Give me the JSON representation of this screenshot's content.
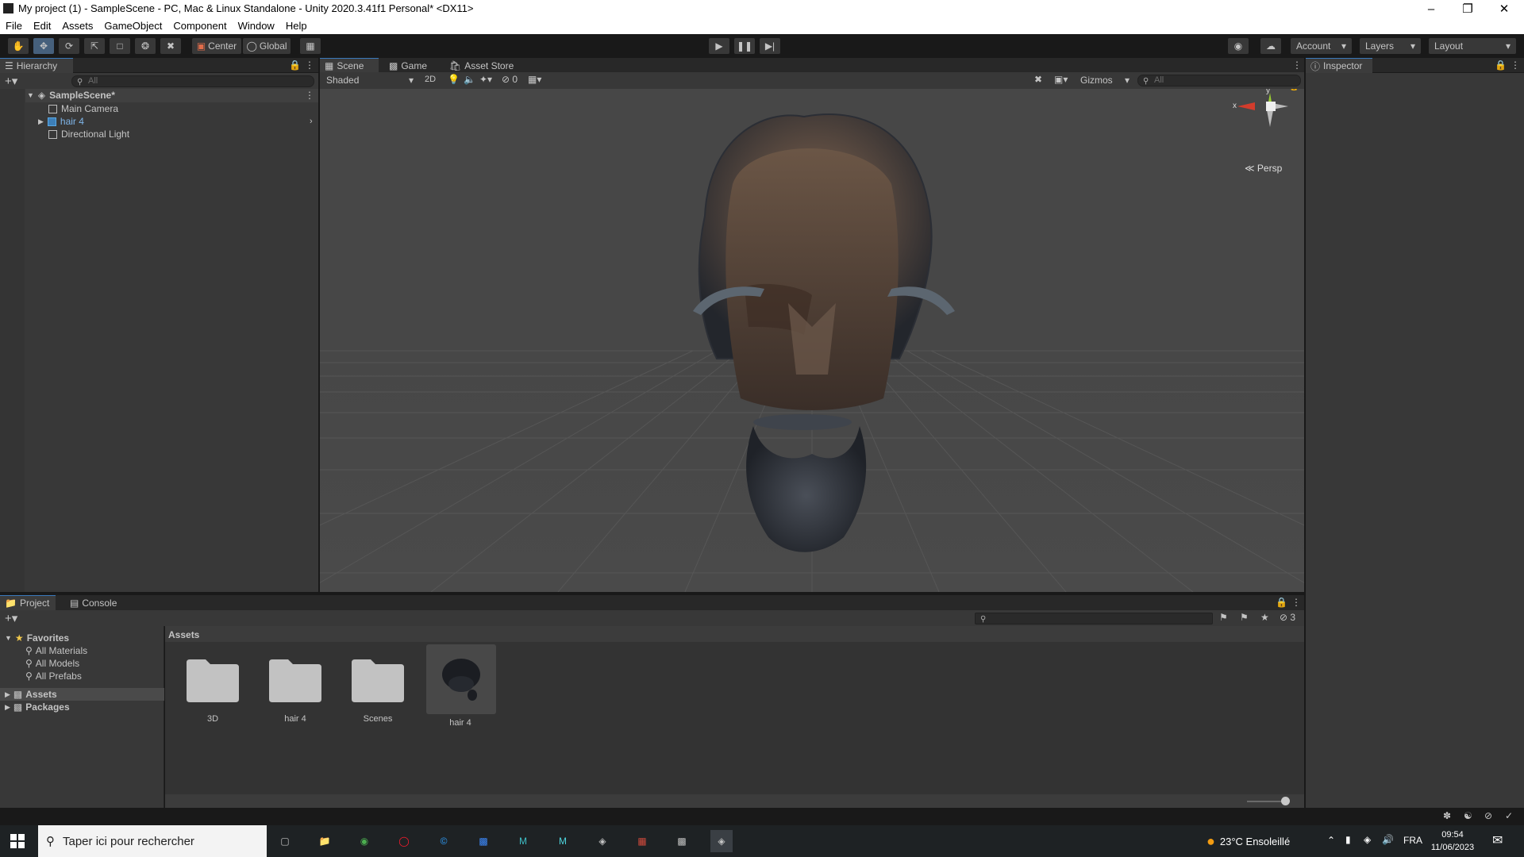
{
  "window": {
    "title": "My project (1) - SampleScene - PC, Mac & Linux Standalone - Unity 2020.3.41f1 Personal* <DX11>"
  },
  "menu": [
    "File",
    "Edit",
    "Assets",
    "GameObject",
    "Component",
    "Window",
    "Help"
  ],
  "toolbar": {
    "pivot": "Center",
    "space": "Global",
    "account": "Account",
    "layers": "Layers",
    "layout": "Layout"
  },
  "hierarchy": {
    "tab": "Hierarchy",
    "search_placeholder": "All",
    "scene": "SampleScene*",
    "items": [
      "Main Camera",
      "hair 4",
      "Directional Light"
    ]
  },
  "scene": {
    "tabs": [
      "Scene",
      "Game",
      "Asset Store"
    ],
    "shading": "Shaded",
    "mode2d": "2D",
    "hidden_count": "0",
    "gizmos": "Gizmos",
    "search_placeholder": "All",
    "gizmo_y": "y",
    "gizmo_x": "x",
    "persp": "Persp"
  },
  "inspector": {
    "tab": "Inspector"
  },
  "project": {
    "tabs": [
      "Project",
      "Console"
    ],
    "hidden_count": "3",
    "favorites_label": "Favorites",
    "favorites": [
      "All Materials",
      "All Models",
      "All Prefabs"
    ],
    "roots": [
      "Assets",
      "Packages"
    ],
    "breadcrumb": "Assets",
    "assets": [
      {
        "name": "3D",
        "kind": "folder"
      },
      {
        "name": "hair 4",
        "kind": "folder"
      },
      {
        "name": "Scenes",
        "kind": "folder"
      },
      {
        "name": "hair 4",
        "kind": "model"
      }
    ]
  },
  "taskbar": {
    "search_placeholder": "Taper ici pour rechercher",
    "weather": "23°C  Ensoleillé",
    "language": "FRA",
    "time": "09:54",
    "date": "11/06/2023"
  },
  "colors": {
    "accent": "#3a79bb",
    "panel": "#383838",
    "selected": "#46607c"
  }
}
